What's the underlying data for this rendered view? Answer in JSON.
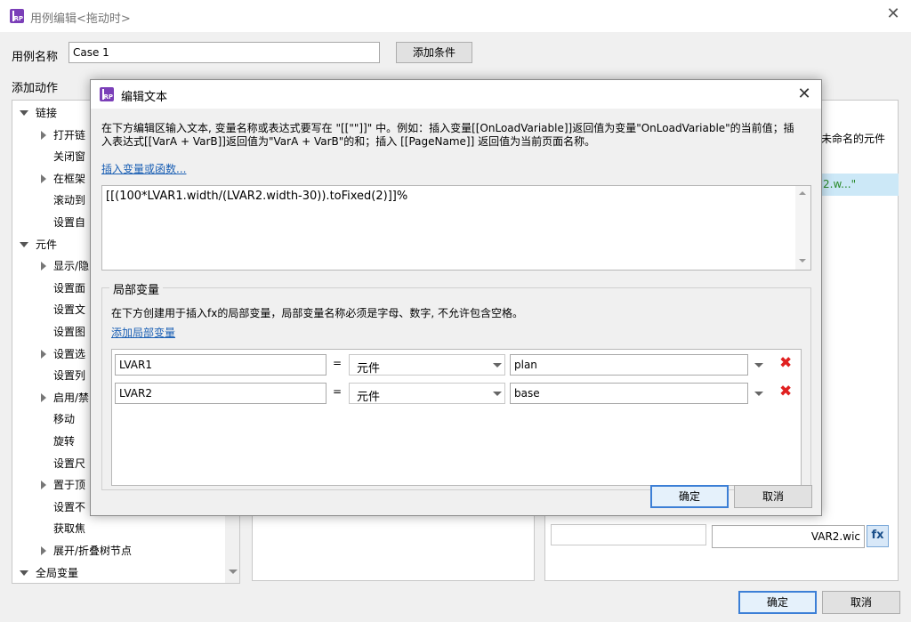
{
  "main_window": {
    "title": "用例编辑<拖动时>",
    "case_name_label": "用例名称",
    "case_name_value": "Case 1",
    "add_condition_label": "添加条件",
    "add_action_label": "添加动作",
    "tree": [
      {
        "label": "链接",
        "expand": "down",
        "indent": 0
      },
      {
        "label": "打开链",
        "expand": "right",
        "indent": 1
      },
      {
        "label": "关闭窗",
        "expand": "none",
        "indent": 1
      },
      {
        "label": "在框架",
        "expand": "right",
        "indent": 1
      },
      {
        "label": "滚动到",
        "expand": "none",
        "indent": 1
      },
      {
        "label": "设置自",
        "expand": "none",
        "indent": 1
      },
      {
        "label": "元件",
        "expand": "down",
        "indent": 0
      },
      {
        "label": "显示/隐",
        "expand": "right",
        "indent": 1
      },
      {
        "label": "设置面",
        "expand": "none",
        "indent": 1
      },
      {
        "label": "设置文",
        "expand": "none",
        "indent": 1
      },
      {
        "label": "设置图",
        "expand": "none",
        "indent": 1
      },
      {
        "label": "设置选",
        "expand": "right",
        "indent": 1
      },
      {
        "label": "设置列",
        "expand": "none",
        "indent": 1
      },
      {
        "label": "启用/禁",
        "expand": "right",
        "indent": 1
      },
      {
        "label": "移动",
        "expand": "none",
        "indent": 1
      },
      {
        "label": "旋转",
        "expand": "none",
        "indent": 1
      },
      {
        "label": "设置尺",
        "expand": "none",
        "indent": 1
      },
      {
        "label": "置于顶",
        "expand": "right",
        "indent": 1
      },
      {
        "label": "设置不",
        "expand": "none",
        "indent": 1
      },
      {
        "label": "获取焦",
        "expand": "none",
        "indent": 1
      },
      {
        "label": "展开/折叠树节点",
        "expand": "right",
        "indent": 1
      },
      {
        "label": "全局变量",
        "expand": "down",
        "indent": 0
      }
    ],
    "right_header": "未命名的元件",
    "right_selected_text": "2.w...\"",
    "bottom_field_value": "VAR2.wic",
    "fx_label": "fx",
    "ok_label": "确定",
    "cancel_label": "取消"
  },
  "dialog": {
    "title": "编辑文本",
    "instructions": "在下方编辑区输入文本, 变量名称或表达式要写在 \"[[\"\"]]\" 中。例如：插入变量[[OnLoadVariable]]返回值为变量\"OnLoadVariable\"的当前值；插入表达式[[VarA + VarB]]返回值为\"VarA + VarB\"的和；插入 [[PageName]] 返回值为当前页面名称。",
    "insert_link": "插入变量或函数...",
    "editor_text": "[[(100*LVAR1.width/(LVAR2.width-30)).toFixed(2)]]%",
    "local_vars_legend": "局部变量",
    "local_vars_desc": "在下方创建用于插入fx的局部变量，局部变量名称必须是字母、数字, 不允许包含空格。",
    "add_local_var_link": "添加局部变量",
    "variables": [
      {
        "name": "LVAR1",
        "equals": "=",
        "type": "元件",
        "target": "plan"
      },
      {
        "name": "LVAR2",
        "equals": "=",
        "type": "元件",
        "target": "base"
      }
    ],
    "ok_label": "确定",
    "cancel_label": "取消"
  }
}
